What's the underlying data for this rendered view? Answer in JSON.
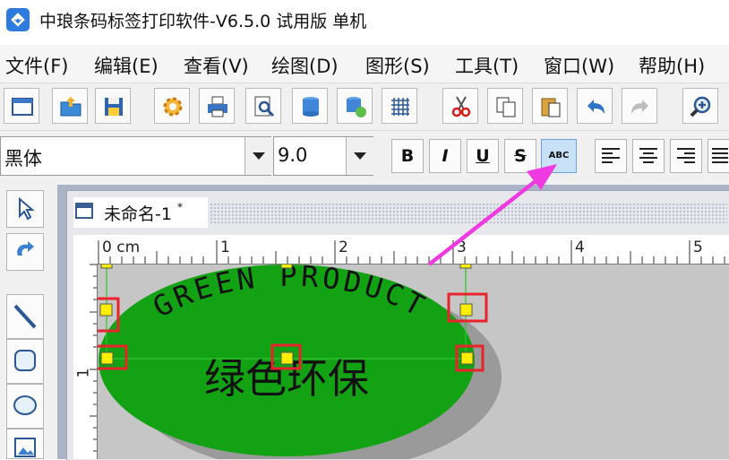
{
  "window": {
    "title": "中琅条码标签打印软件-V6.5.0 试用版 单机",
    "app_icon": "app-logo-icon"
  },
  "menu": [
    {
      "label": "文件(F)"
    },
    {
      "label": "编辑(E)"
    },
    {
      "label": "查看(V)"
    },
    {
      "label": "绘图(D)"
    },
    {
      "label": "图形(S)"
    },
    {
      "label": "工具(T)"
    },
    {
      "label": "窗口(W)"
    },
    {
      "label": "帮助(H)"
    }
  ],
  "toolbar": {
    "icons": [
      "new-window-icon",
      "open-folder-icon",
      "save-disk-icon",
      "settings-gear-icon",
      "print-icon",
      "print-preview-icon",
      "database-icon",
      "database-settings-icon",
      "grid-icon",
      "cut-scissors-icon",
      "copy-icon",
      "paste-icon",
      "undo-icon",
      "redo-icon",
      "zoom-in-icon"
    ]
  },
  "format_bar": {
    "font_name": "黑体",
    "font_size": "9.0",
    "bold_label": "B",
    "italic_label": "I",
    "underline_label": "U",
    "strike_label": "S",
    "arc_text_label": "ABC",
    "align_icons": [
      "align-left-icon",
      "align-center-icon",
      "align-right-icon",
      "align-justify-icon"
    ]
  },
  "left_tools": [
    "select-arrow-icon",
    "rotate-icon",
    "line-tool-icon",
    "rounded-rect-tool-icon",
    "ellipse-tool-icon",
    "image-tool-icon"
  ],
  "document": {
    "tab_title": "未命名-1",
    "tab_close": "*",
    "ruler_unit": "0 cm",
    "ruler_top_labels": [
      "1",
      "2",
      "3",
      "4",
      "5"
    ],
    "ruler_left_labels": [
      "1"
    ]
  },
  "label": {
    "arc_text": "GREEN PRODUCT",
    "center_text": "绿色环保",
    "ellipse_color": "#13a213",
    "shadow_color": "#9a9a9a",
    "handle_color": "#ffee00",
    "highlight_color": "#e8232b"
  },
  "annotation": {
    "arrow_color": "#ee3ae0"
  }
}
